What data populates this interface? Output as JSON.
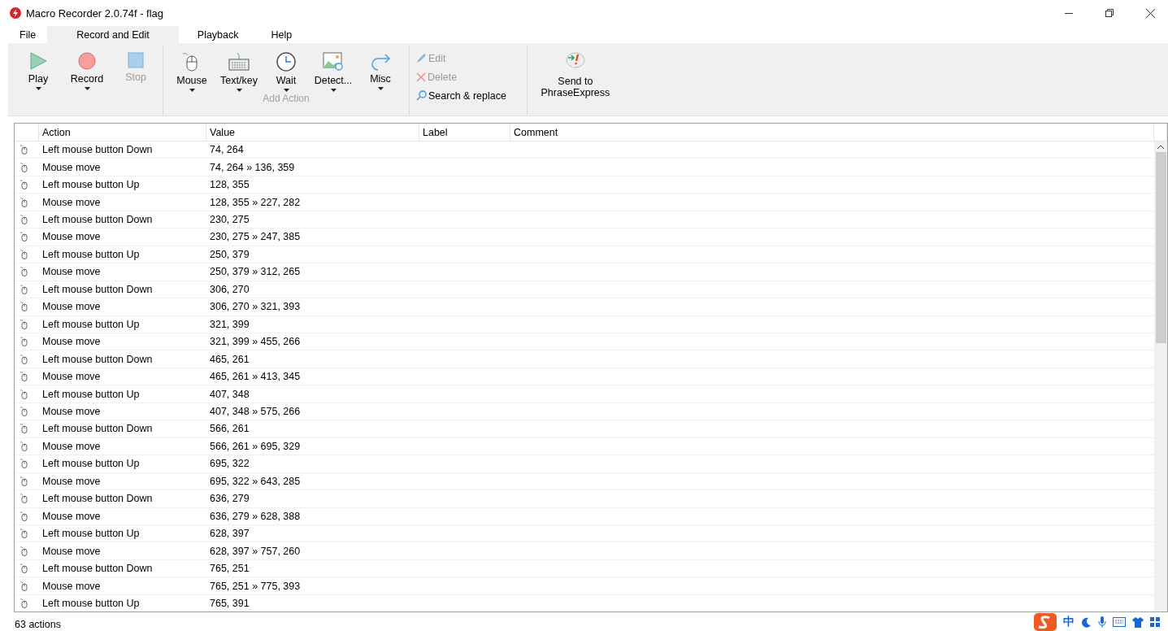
{
  "window": {
    "title": "Macro Recorder 2.0.74f - flag"
  },
  "tabs": [
    {
      "label": "File",
      "selected": false
    },
    {
      "label": "Record and Edit",
      "selected": true
    },
    {
      "label": "Playback",
      "selected": false
    },
    {
      "label": "Help",
      "selected": false
    }
  ],
  "ribbon": {
    "groups": [
      {
        "buttons": [
          {
            "kind": "play",
            "label": "Play",
            "dropdown": true,
            "disabled": false
          },
          {
            "kind": "record",
            "label": "Record",
            "dropdown": true,
            "disabled": false
          },
          {
            "kind": "stop",
            "label": "Stop",
            "dropdown": false,
            "disabled": true
          }
        ]
      },
      {
        "caption": "Add Action",
        "buttons": [
          {
            "kind": "mouse",
            "label": "Mouse",
            "dropdown": true,
            "disabled": false
          },
          {
            "kind": "keyboard",
            "label": "Text/key",
            "dropdown": true,
            "disabled": false
          },
          {
            "kind": "wait",
            "label": "Wait",
            "dropdown": true,
            "disabled": false
          },
          {
            "kind": "detect",
            "label": "Detect...",
            "dropdown": true,
            "disabled": false
          },
          {
            "kind": "misc",
            "label": "Misc",
            "dropdown": true,
            "disabled": false
          }
        ]
      }
    ],
    "small_buttons": [
      {
        "kind": "edit",
        "label": "Edit",
        "disabled": true
      },
      {
        "kind": "delete",
        "label": "Delete",
        "disabled": true
      },
      {
        "kind": "search",
        "label": "Search & replace",
        "disabled": false
      }
    ],
    "send_button": {
      "label": "Send to PhraseExpress"
    }
  },
  "table": {
    "columns": [
      "Action",
      "Value",
      "Label",
      "Comment"
    ],
    "rows": [
      [
        "Left mouse button Down",
        "74, 264"
      ],
      [
        "Mouse move",
        "74, 264 » 136, 359"
      ],
      [
        "Left mouse button Up",
        "128, 355"
      ],
      [
        "Mouse move",
        "128, 355 » 227, 282"
      ],
      [
        "Left mouse button Down",
        "230, 275"
      ],
      [
        "Mouse move",
        "230, 275 » 247, 385"
      ],
      [
        "Left mouse button Up",
        "250, 379"
      ],
      [
        "Mouse move",
        "250, 379 » 312, 265"
      ],
      [
        "Left mouse button Down",
        "306, 270"
      ],
      [
        "Mouse move",
        "306, 270 » 321, 393"
      ],
      [
        "Left mouse button Up",
        "321, 399"
      ],
      [
        "Mouse move",
        "321, 399 » 455, 266"
      ],
      [
        "Left mouse button Down",
        "465, 261"
      ],
      [
        "Mouse move",
        "465, 261 » 413, 345"
      ],
      [
        "Left mouse button Up",
        "407, 348"
      ],
      [
        "Mouse move",
        "407, 348 » 575, 266"
      ],
      [
        "Left mouse button Down",
        "566, 261"
      ],
      [
        "Mouse move",
        "566, 261 » 695, 329"
      ],
      [
        "Left mouse button Up",
        "695, 322"
      ],
      [
        "Mouse move",
        "695, 322 » 643, 285"
      ],
      [
        "Left mouse button Down",
        "636, 279"
      ],
      [
        "Mouse move",
        "636, 279 » 628, 388"
      ],
      [
        "Left mouse button Up",
        "628, 397"
      ],
      [
        "Mouse move",
        "628, 397 » 757, 260"
      ],
      [
        "Left mouse button Down",
        "765, 251"
      ],
      [
        "Mouse move",
        "765, 251 » 775, 393"
      ],
      [
        "Left mouse button Up",
        "765, 391"
      ]
    ]
  },
  "status_bar": {
    "text": "63 actions"
  },
  "ime_bar": {
    "mode": "中"
  }
}
